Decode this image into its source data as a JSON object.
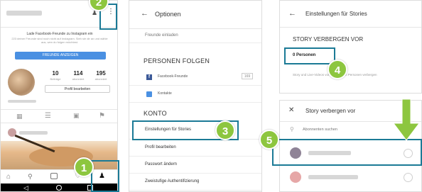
{
  "panel1": {
    "invite_text": "Lade Facebook-Freunde zu Instagram ein",
    "invite_sub": "223 deiner Freunde sind noch nicht auf Instagram. Sieh sie dir an und wähle aus, wen du folgen möchtest.",
    "find_friends_button": "FREUNDE ANZEIGEN",
    "stats": [
      {
        "value": "10",
        "label": "Beiträge"
      },
      {
        "value": "114",
        "label": "abonniert"
      },
      {
        "value": "195",
        "label": "abonniert"
      }
    ],
    "edit_profile_button": "Profil bearbeiten"
  },
  "panel2": {
    "title": "Optionen",
    "top_item": "Freunde einladen",
    "section_follow": "PERSONEN FOLGEN",
    "follow_items": [
      {
        "label": "Facebook-Freunde",
        "count": "169"
      },
      {
        "label": "Kontakte",
        "count": ""
      }
    ],
    "section_account": "KONTO",
    "account_items": [
      "Einstellungen für Stories",
      "Profil bearbeiten",
      "Passwort ändern",
      "Zweistufige Authentifizierung"
    ]
  },
  "panel3": {
    "title": "Einstellungen für Stories",
    "section": "STORY VERBERGEN VOR",
    "value": "0 Personen",
    "hint": "Story und Live-Videos vor abonnierten Personen verbergen"
  },
  "panel4": {
    "title": "Story verbergen vor",
    "search_placeholder": "Abonnenten suchen"
  },
  "badges": [
    "1",
    "2",
    "3",
    "4",
    "5"
  ],
  "colors": {
    "highlight": "#1b7a96",
    "badge": "#8dc63f",
    "facebook_blue": "#4a90e2"
  }
}
